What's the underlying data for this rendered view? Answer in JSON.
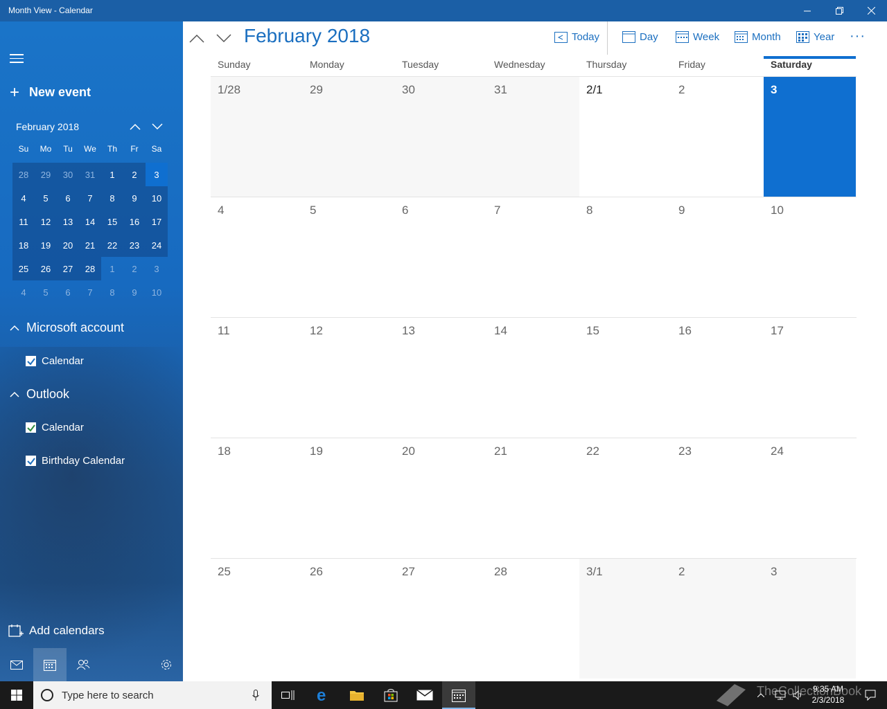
{
  "window": {
    "title": "Month View - Calendar"
  },
  "sidebar": {
    "new_event": "New event",
    "mini": {
      "title": "February 2018",
      "dow": [
        "Su",
        "Mo",
        "Tu",
        "We",
        "Th",
        "Fr",
        "Sa"
      ],
      "weeks": [
        [
          "28",
          "29",
          "30",
          "31",
          "1",
          "2",
          "3"
        ],
        [
          "4",
          "5",
          "6",
          "7",
          "8",
          "9",
          "10"
        ],
        [
          "11",
          "12",
          "13",
          "14",
          "15",
          "16",
          "17"
        ],
        [
          "18",
          "19",
          "20",
          "21",
          "22",
          "23",
          "24"
        ],
        [
          "25",
          "26",
          "27",
          "28",
          "1",
          "2",
          "3"
        ],
        [
          "4",
          "5",
          "6",
          "7",
          "8",
          "9",
          "10"
        ]
      ]
    },
    "accounts": [
      {
        "name": "Microsoft account",
        "calendars": [
          {
            "label": "Calendar",
            "color": "#1b6fc0"
          }
        ]
      },
      {
        "name": "Outlook",
        "calendars": [
          {
            "label": "Calendar",
            "color": "#2e8b3d"
          },
          {
            "label": "Birthday Calendar",
            "color": "#1b6fc0"
          }
        ]
      }
    ],
    "add_calendars": "Add calendars"
  },
  "toolbar": {
    "month_title": "February 2018",
    "today": "Today",
    "day": "Day",
    "week": "Week",
    "month": "Month",
    "year": "Year",
    "more": "···"
  },
  "grid": {
    "dow": [
      "Sunday",
      "Monday",
      "Tuesday",
      "Wednesday",
      "Thursday",
      "Friday",
      "Saturday"
    ],
    "weeks": [
      [
        "1/28",
        "29",
        "30",
        "31",
        "2/1",
        "2",
        "3"
      ],
      [
        "4",
        "5",
        "6",
        "7",
        "8",
        "9",
        "10"
      ],
      [
        "11",
        "12",
        "13",
        "14",
        "15",
        "16",
        "17"
      ],
      [
        "18",
        "19",
        "20",
        "21",
        "22",
        "23",
        "24"
      ],
      [
        "25",
        "26",
        "27",
        "28",
        "3/1",
        "2",
        "3"
      ]
    ]
  },
  "taskbar": {
    "search_placeholder": "Type here to search",
    "time": "9:35 AM",
    "date": "2/3/2018",
    "watermark": "TheCollectionBook"
  },
  "colors": {
    "accent": "#0f6fd0",
    "titlebar": "#1b5fa6"
  }
}
